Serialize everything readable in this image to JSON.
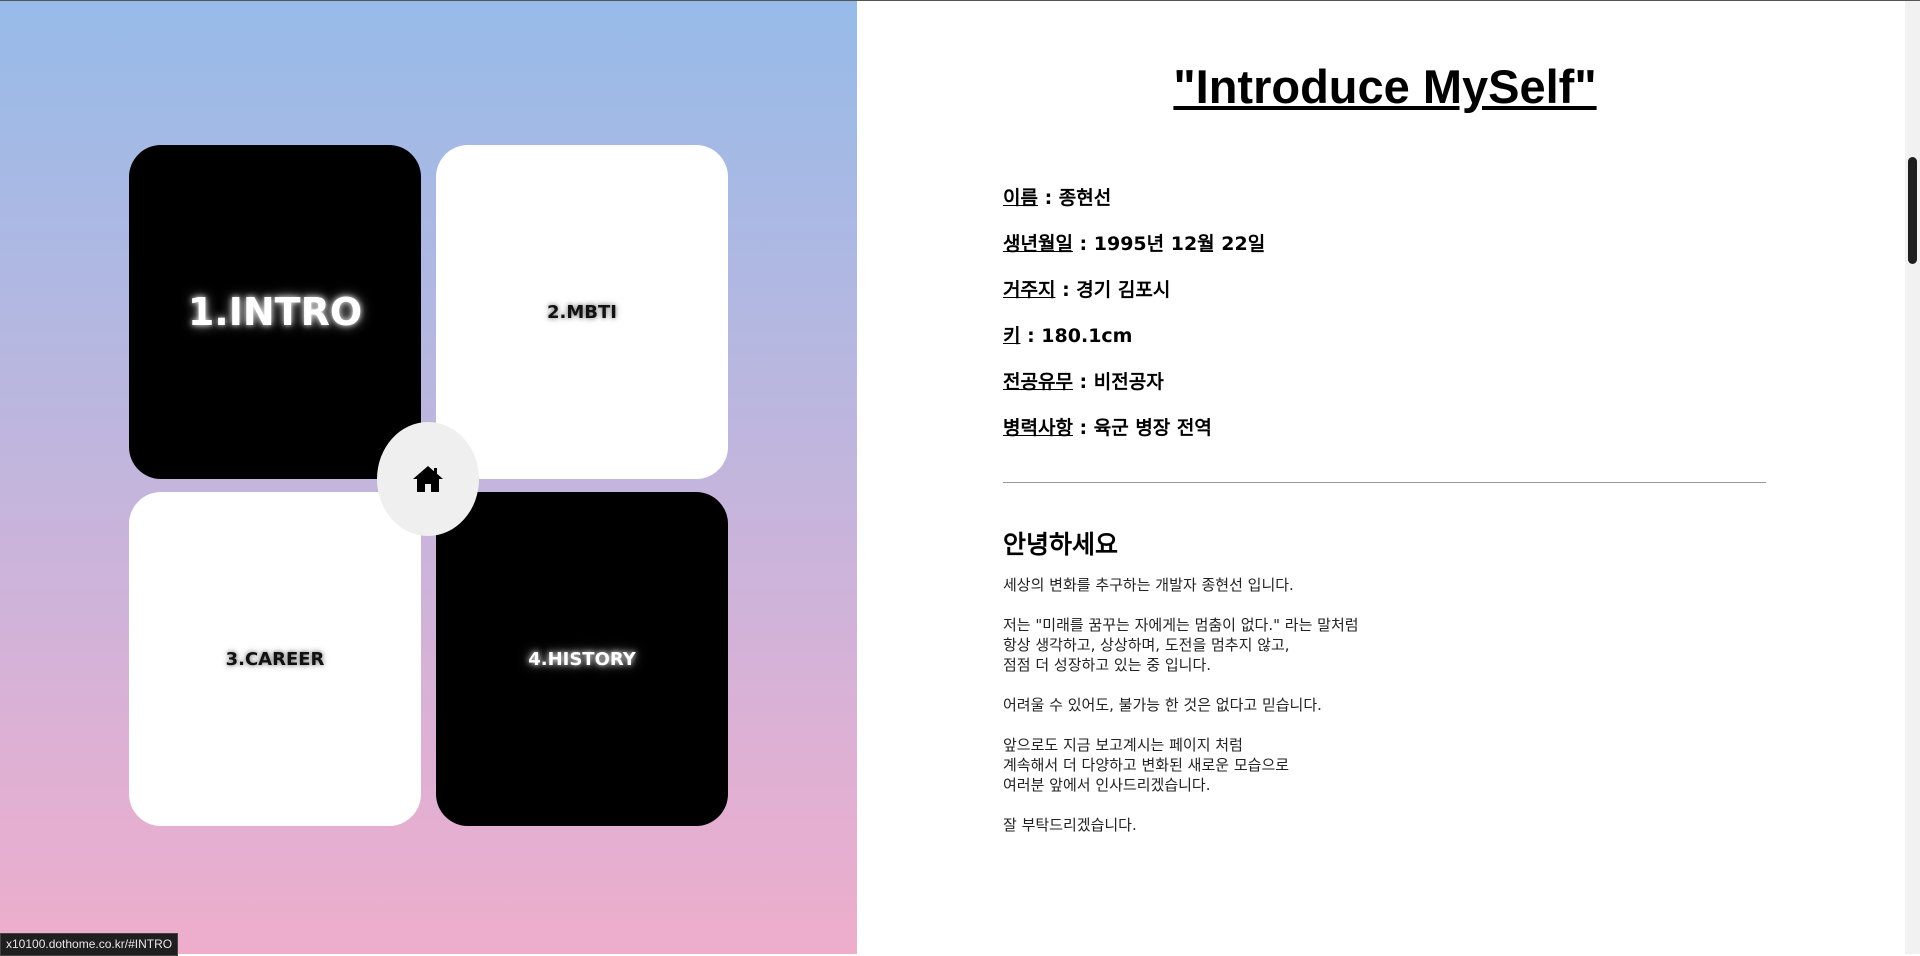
{
  "nav": {
    "cards": [
      {
        "label": "1.INTRO"
      },
      {
        "label": "2.MBTI"
      },
      {
        "label": "3.CAREER"
      },
      {
        "label": "4.HISTORY"
      }
    ],
    "home_icon": "home-icon"
  },
  "status_bar": {
    "url": "x10100.dothome.co.kr/#INTRO"
  },
  "intro": {
    "title": "\"Introduce MySelf\"",
    "info": [
      {
        "label": "이름",
        "value": " : 종현선"
      },
      {
        "label": "생년월일",
        "value": " : 1995년 12월 22일"
      },
      {
        "label": "거주지",
        "value": " : 경기 김포시"
      },
      {
        "label": "키",
        "value": " : 180.1cm"
      },
      {
        "label": "전공유무",
        "value": " : 비전공자"
      },
      {
        "label": "병력사항",
        "value": " : 육군 병장 전역"
      }
    ],
    "greeting": "안녕하세요",
    "paragraphs": [
      "세상의 변화를 추구하는 개발자 종현선 입니다.",
      "저는 \"미래를 꿈꾸는 자에게는 멈춤이 없다.\" 라는 말처럼\n항상 생각하고, 상상하며, 도전을 멈추지 않고,\n점점 더 성장하고 있는 중 입니다.",
      "어려울 수 있어도, 불가능 한 것은 없다고 믿습니다.",
      "앞으로도 지금 보고계시는 페이지 처럼\n계속해서 더 다양하고 변화된 새로운 모습으로\n여러분 앞에서 인사드리겠습니다.",
      "잘 부탁드리겠습니다."
    ]
  },
  "colors": {
    "gradient_top": "#97bbe9",
    "gradient_bottom": "#eeadcb",
    "card_dark": "#000000",
    "card_light": "#ffffff"
  }
}
